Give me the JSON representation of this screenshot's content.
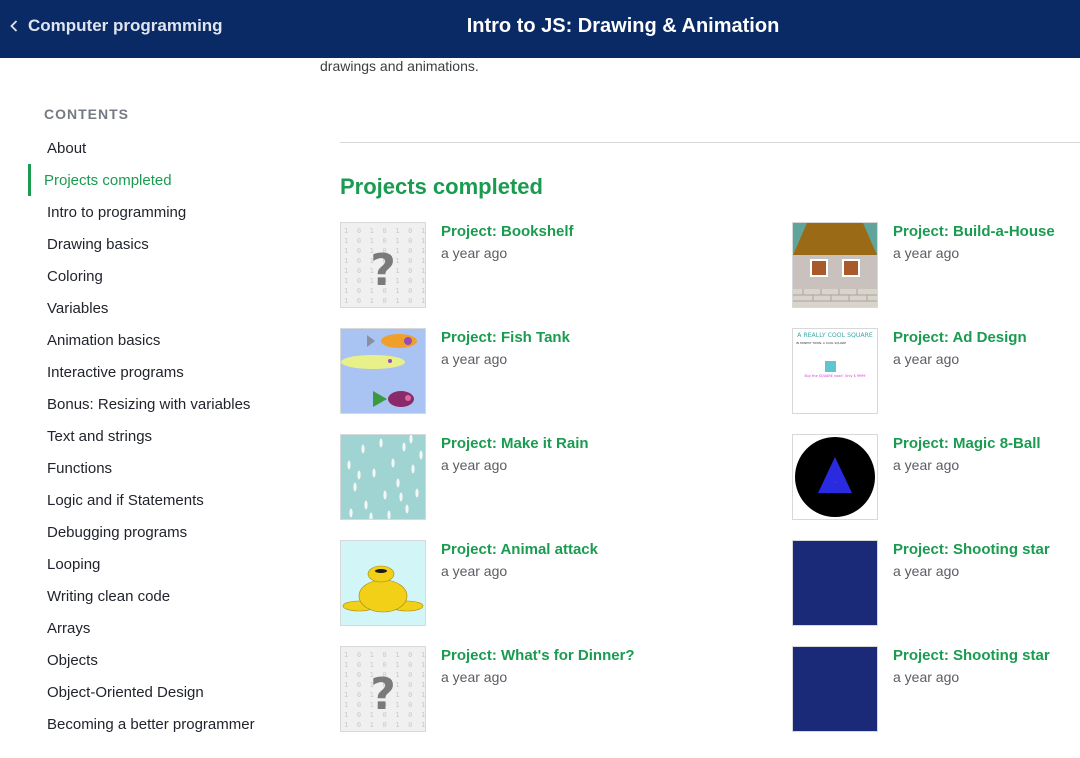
{
  "header": {
    "back_label": "Computer programming",
    "title": "Intro to JS: Drawing & Animation"
  },
  "intro_text": "drawings and animations.",
  "contents": {
    "heading": "CONTENTS",
    "items": [
      {
        "label": "About"
      },
      {
        "label": "Projects completed",
        "active": true
      },
      {
        "label": "Intro to programming"
      },
      {
        "label": "Drawing basics"
      },
      {
        "label": "Coloring"
      },
      {
        "label": "Variables"
      },
      {
        "label": "Animation basics"
      },
      {
        "label": "Interactive programs"
      },
      {
        "label": "Bonus: Resizing with variables"
      },
      {
        "label": "Text and strings"
      },
      {
        "label": "Functions"
      },
      {
        "label": "Logic and if Statements"
      },
      {
        "label": "Debugging programs"
      },
      {
        "label": "Looping"
      },
      {
        "label": "Writing clean code"
      },
      {
        "label": "Arrays"
      },
      {
        "label": "Objects"
      },
      {
        "label": "Object-Oriented Design"
      },
      {
        "label": "Becoming a better programmer"
      }
    ]
  },
  "projects": {
    "title": "Projects completed",
    "items": [
      {
        "title": "Project: Bookshelf",
        "time": "a year ago",
        "thumb": "placeholder-binary"
      },
      {
        "title": "Project: Build-a-House",
        "time": "a year ago",
        "thumb": "house"
      },
      {
        "title": "Project: Fish Tank",
        "time": "a year ago",
        "thumb": "fish-tank"
      },
      {
        "title": "Project: Ad Design",
        "time": "a year ago",
        "thumb": "ad-design",
        "thumb_text": {
          "headline": "A REALLY COOL SQUARE",
          "sub": "IN HONEST TOWN, A COOL SQUARE",
          "cta": "Buy the SQUARE now!! Only $ 9999"
        }
      },
      {
        "title": "Project: Make it Rain",
        "time": "a year ago",
        "thumb": "rain"
      },
      {
        "title": "Project: Magic 8-Ball",
        "time": "a year ago",
        "thumb": "magic-8-ball"
      },
      {
        "title": "Project: Animal attack",
        "time": "a year ago",
        "thumb": "animal"
      },
      {
        "title": "Project: Shooting star",
        "time": "a year ago",
        "thumb": "solid-navy"
      },
      {
        "title": "Project: What's for Dinner?",
        "time": "a year ago",
        "thumb": "placeholder-binary"
      },
      {
        "title": "Project: Shooting star",
        "time": "a year ago",
        "thumb": "solid-navy"
      }
    ]
  },
  "colors": {
    "header_bg": "#0a2a66",
    "accent_green": "#1a9b50",
    "navy_thumb": "#1b2a78"
  }
}
